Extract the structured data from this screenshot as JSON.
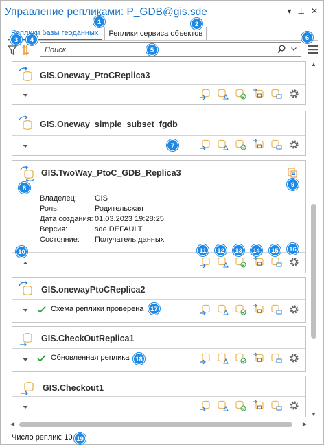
{
  "header": {
    "title": "Управление репликами: P_GDB@gis.sde",
    "controls": [
      "▾",
      "⊥",
      "✕"
    ]
  },
  "tabs": [
    {
      "label": "Реплики базы геоданных",
      "active": true
    },
    {
      "label": "Реплики сервиса объектов",
      "active": false
    }
  ],
  "search": {
    "placeholder": "Поиск"
  },
  "replicas": [
    {
      "name": "GIS.Oneway_PtoCReplica3",
      "status": "",
      "expanded": false
    },
    {
      "name": "GIS.Oneway_simple_subset_fgdb",
      "status": "",
      "expanded": false
    },
    {
      "name": "GIS.TwoWay_PtoC_GDB_Replica3",
      "status": "",
      "expanded": true,
      "details": [
        {
          "k": "Владелец:",
          "v": "GIS"
        },
        {
          "k": "Роль:",
          "v": "Родительская"
        },
        {
          "k": "Дата создания:",
          "v": "01.03.2023 19:28:25"
        },
        {
          "k": "Версия:",
          "v": "sde.DEFAULT"
        },
        {
          "k": "Состояние:",
          "v": "Получатель данных"
        }
      ]
    },
    {
      "name": "GIS.onewayPtoCReplica2",
      "status": "Схема реплики проверена",
      "expanded": false
    },
    {
      "name": "GIS.CheckOutReplica1",
      "status": "Обновленная реплика",
      "expanded": false
    },
    {
      "name": "GIS.Checkout1",
      "status": "",
      "expanded": false
    }
  ],
  "footer": {
    "label": "Число реплик: 10"
  },
  "callouts": [
    "1",
    "2",
    "3",
    "4",
    "5",
    "6",
    "7",
    "8",
    "9",
    "10",
    "11",
    "12",
    "13",
    "14",
    "15",
    "16",
    "17",
    "18",
    "19"
  ],
  "colors": {
    "accent": "#1a73c8",
    "callout": "#1e88e5",
    "ok": "#2e9e3e",
    "db": "#e8a93a",
    "arrow": "#2a7fd4"
  }
}
